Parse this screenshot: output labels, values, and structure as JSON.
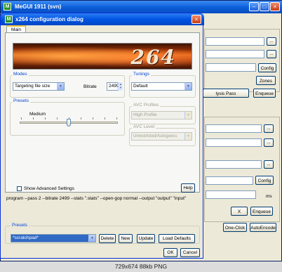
{
  "bg_window": {
    "title": "MeGUI 1911 (svn)",
    "app_icon": "M",
    "buttons": {
      "ellipsis": "...",
      "config": "Config",
      "zones": "Zones",
      "analysis_pass": "lysis Pass",
      "enqueue": "Enqueue",
      "x": "X",
      "one_click": "One-Click",
      "autoencode": "AutoEncode"
    },
    "ms_label": "ms"
  },
  "dialog": {
    "title": "x264 configuration dialog",
    "app_icon": "M",
    "tab_main": "Main",
    "banner_text": "264",
    "modes": {
      "label": "Modes",
      "mode_value": "Targeting file size",
      "bitrate_label": "Bitrate",
      "bitrate_value": "2499"
    },
    "tunings": {
      "label": "Tunings",
      "value": "Default"
    },
    "presets_group": {
      "label": "Presets",
      "level_label": "Medium",
      "level_fraction": 0.5
    },
    "avc_profiles": {
      "label": "AVC Profiles",
      "value": "High Profile"
    },
    "avc_level": {
      "label": "AVC Level",
      "value": "Unrestricted/Autoguess"
    },
    "show_advanced": "Show Advanced Settings",
    "help_button": "Help",
    "command_line": "program --pass 2 --bitrate 2499 --stats \".stats\" --open-gop normal --output \"output\" \"input\"",
    "presets_bottom": {
      "label": "Presets",
      "value": "*scratchpad*",
      "delete": "Delete",
      "new": "New",
      "update": "Update",
      "load_defaults": "Load Defaults"
    },
    "ok": "OK",
    "cancel": "Cancel"
  },
  "caption": "729x674 88kb PNG"
}
